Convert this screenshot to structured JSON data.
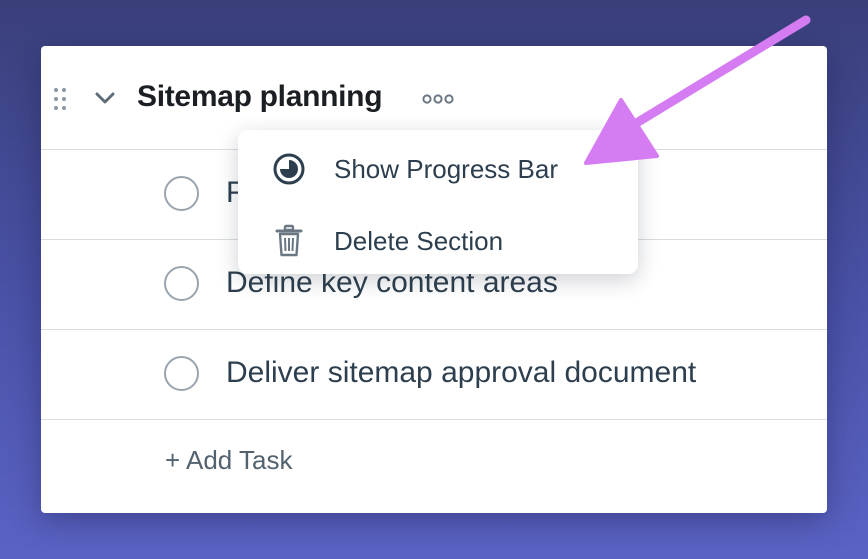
{
  "section": {
    "title": "Sitemap planning",
    "drag_handle_icon": "drag-handle-icon",
    "collapse_icon": "chevron-down-icon",
    "more_icon": "more-options-icon"
  },
  "tasks": [
    {
      "label": "F",
      "status_icon": "circle-check-icon"
    },
    {
      "label": "Define key content areas",
      "status_icon": "circle-check-icon"
    },
    {
      "label": "Deliver sitemap approval document",
      "status_icon": "circle-check-icon"
    }
  ],
  "add_task_label": "+ Add Task",
  "menu": {
    "items": [
      {
        "label": "Show Progress Bar",
        "icon": "progress-pie-icon"
      },
      {
        "label": "Delete Section",
        "icon": "trash-icon"
      }
    ]
  },
  "annotation": {
    "arrow_color": "#d67cf2",
    "points_to": "Show Progress Bar"
  }
}
